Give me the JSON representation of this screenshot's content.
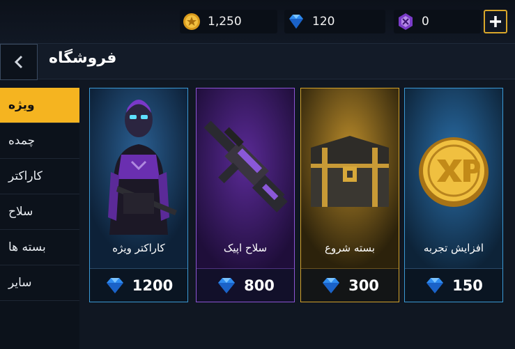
{
  "currencies": {
    "coins": "1,250",
    "gems": "120",
    "tokens": "0"
  },
  "header": {
    "title": "فروشگاه"
  },
  "sidebar": {
    "items": [
      {
        "label": "ویژه",
        "active": true
      },
      {
        "label": "چمده",
        "active": false
      },
      {
        "label": "کاراکتر",
        "active": false
      },
      {
        "label": "سلاح",
        "active": false
      },
      {
        "label": "بسته ها",
        "active": false
      },
      {
        "label": "سایر",
        "active": false
      }
    ]
  },
  "cards": [
    {
      "name": "کاراکتر ویژه",
      "price": "1200",
      "art": "purple-soldier-art"
    },
    {
      "name": "سلاح اپیک",
      "price": "800",
      "art": "purple-rifle-art"
    },
    {
      "name": "بسته شروع",
      "price": "300",
      "art": "gold-chest-art"
    },
    {
      "name": "افزایش تجربه",
      "price": "150",
      "art": "xp-coin-art"
    }
  ],
  "colors": {
    "accent": "#f5b420",
    "gem": "#2f8cf0",
    "epic": "#8d55d6"
  }
}
